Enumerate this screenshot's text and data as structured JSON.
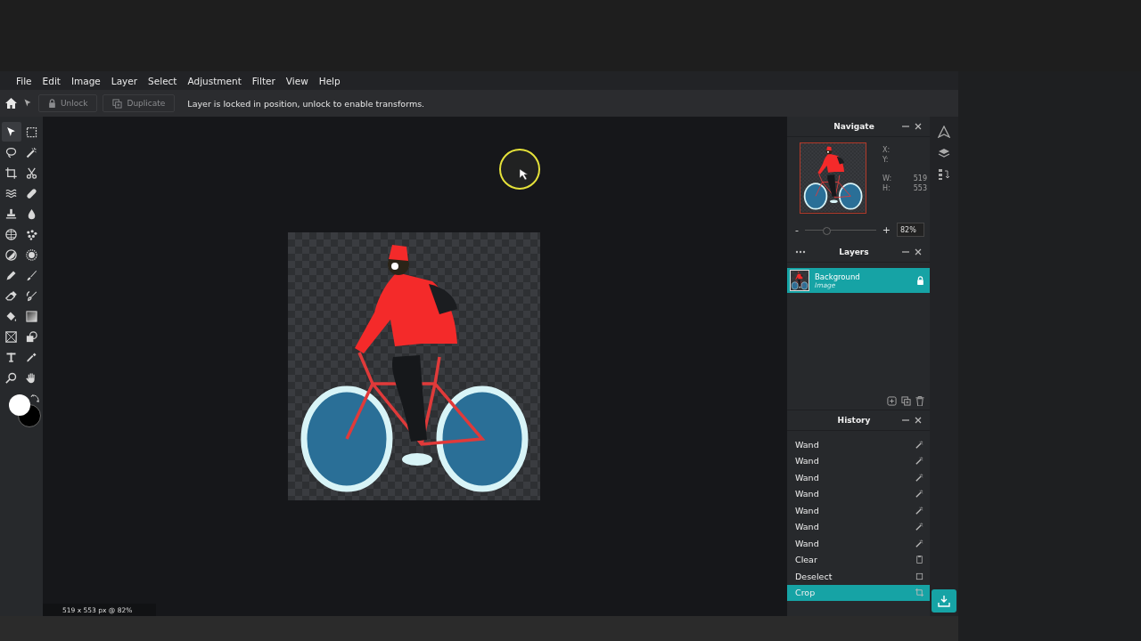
{
  "menu": [
    "File",
    "Edit",
    "Image",
    "Layer",
    "Select",
    "Adjustment",
    "Filter",
    "View",
    "Help"
  ],
  "toolbar": {
    "buttons": [
      {
        "kind": "unlock",
        "label": "Unlock",
        "disabled": true
      },
      {
        "kind": "duplicate",
        "label": "Duplicate",
        "disabled": true
      }
    ],
    "message": "Layer is locked in position, unlock to enable transforms."
  },
  "tools": [
    {
      "kind": "pointer",
      "selected": true
    },
    {
      "kind": "marquee",
      "selected": false
    },
    {
      "kind": "lasso",
      "selected": false
    },
    {
      "kind": "wand",
      "selected": false
    },
    {
      "kind": "crop",
      "selected": false
    },
    {
      "kind": "scissors",
      "selected": false
    },
    {
      "kind": "waves",
      "selected": false
    },
    {
      "kind": "bandage",
      "selected": false
    },
    {
      "kind": "stamp",
      "selected": false
    },
    {
      "kind": "drop",
      "selected": false
    },
    {
      "kind": "globe",
      "selected": false
    },
    {
      "kind": "dots",
      "selected": false
    },
    {
      "kind": "half-circle",
      "selected": false
    },
    {
      "kind": "ring",
      "selected": false
    },
    {
      "kind": "pencil",
      "selected": false
    },
    {
      "kind": "brush",
      "selected": false
    },
    {
      "kind": "eraser",
      "selected": false
    },
    {
      "kind": "smudge",
      "selected": false
    },
    {
      "kind": "bucket",
      "selected": false
    },
    {
      "kind": "gradient",
      "selected": false
    },
    {
      "kind": "frame",
      "selected": false
    },
    {
      "kind": "shape",
      "selected": false
    },
    {
      "kind": "text",
      "selected": false
    },
    {
      "kind": "eyedropper",
      "selected": false
    },
    {
      "kind": "search",
      "selected": false
    },
    {
      "kind": "hand",
      "selected": false
    }
  ],
  "swatches": [
    {
      "kind": "foreground",
      "color": "#ffffff"
    },
    {
      "kind": "background",
      "color": "#000000"
    }
  ],
  "status": "519 x 553 px @ 82%",
  "navigate": {
    "title": "Navigate",
    "fields": [
      {
        "label": "X:"
      },
      {
        "label": "Y:"
      },
      {
        "label": "W:",
        "value": "519"
      },
      {
        "label": "H:",
        "value": "553"
      }
    ],
    "zoom": {
      "minus": "-",
      "plus": "+",
      "level": 0.3,
      "value": "82%"
    }
  },
  "layers": {
    "title": "Layers",
    "items": [
      {
        "name": "Background",
        "type": "Image",
        "selected": true,
        "locked": true
      }
    ]
  },
  "history": {
    "title": "History",
    "items": [
      {
        "label": "Wand",
        "kind": "wand",
        "selected": false
      },
      {
        "label": "Wand",
        "kind": "wand",
        "selected": false
      },
      {
        "label": "Wand",
        "kind": "wand",
        "selected": false
      },
      {
        "label": "Wand",
        "kind": "wand",
        "selected": false
      },
      {
        "label": "Wand",
        "kind": "wand",
        "selected": false
      },
      {
        "label": "Wand",
        "kind": "wand",
        "selected": false
      },
      {
        "label": "Wand",
        "kind": "wand",
        "selected": false
      },
      {
        "label": "Clear",
        "kind": "clear",
        "selected": false
      },
      {
        "label": "Deselect",
        "kind": "deselect",
        "selected": false
      },
      {
        "label": "Crop",
        "kind": "crop",
        "selected": true
      }
    ]
  }
}
